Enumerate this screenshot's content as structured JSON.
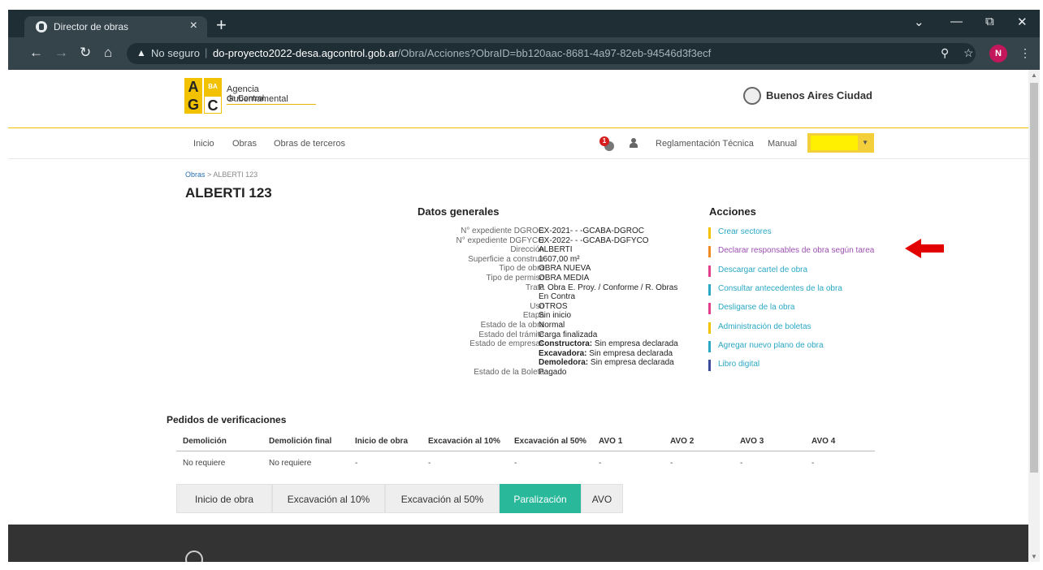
{
  "browser": {
    "tab_title": "Director de obras",
    "tab_close": "×",
    "new_tab": "+",
    "security_label": "No seguro",
    "url_host": "do-proyecto2022-desa.agcontrol.gob.ar",
    "url_path": "/Obra/Acciones?ObraID=bb120aac-8681-4a97-82eb-94546d3f3ecf",
    "profile_initial": "N"
  },
  "header": {
    "logo_line1": "Agencia Gubernamental",
    "logo_line2": "de Control.",
    "logo_letters": [
      "A",
      "BA",
      "G",
      "C"
    ],
    "city_logo": "Buenos Aires Ciudad"
  },
  "nav": {
    "items": [
      "Inicio",
      "Obras",
      "Obras de terceros"
    ],
    "notification_count": "1",
    "reglamentacion": "Reglamentación Técnica",
    "manual": "Manual"
  },
  "breadcrumb": {
    "root": "Obras",
    "separator": ">",
    "current": "ALBERTI 123"
  },
  "obra_title": "ALBERTI 123",
  "datos_generales": {
    "title": "Datos generales",
    "rows": [
      {
        "label": "N° expediente DGROC",
        "value": "EX-2021-               - -GCABA-DGROC"
      },
      {
        "label": "N° expediente DGFYCO",
        "value": "EX-2022-               - -GCABA-DGFYCO"
      },
      {
        "label": "Dirección",
        "value": "ALBERTI"
      },
      {
        "label": "Superficie a construir",
        "value": "1607,00 m²"
      },
      {
        "label": "Tipo de obra",
        "value": "OBRA NUEVA"
      },
      {
        "label": "Tipo de permiso",
        "value": "OBRA MEDIA"
      },
      {
        "label": "Trata",
        "value": "P. Obra E. Proy. / Conforme / R. Obras"
      },
      {
        "label": "",
        "value": "En Contra"
      },
      {
        "label": "Uso",
        "value": "OTROS"
      },
      {
        "label": "Etapa",
        "value": "Sin inicio"
      },
      {
        "label": "Estado de la obra",
        "value": "Normal"
      },
      {
        "label": "Estado del trámite",
        "value": "Carga finalizada"
      }
    ],
    "empresas_label": "Estado de empresas",
    "empresas": [
      {
        "name": "Constructora:",
        "value": " Sin empresa declarada"
      },
      {
        "name": "Excavadora:",
        "value": " Sin empresa declarada"
      },
      {
        "name": "Demoledora:",
        "value": " Sin empresa declarada"
      }
    ],
    "boleta_label": "Estado de la Boleta",
    "boleta_value": "Pagado"
  },
  "acciones": {
    "title": "Acciones",
    "items": [
      {
        "label": "Crear sectores",
        "color": "#f2c200",
        "text_color": "#2aa8c4"
      },
      {
        "label": "Declarar responsables de obra según tarea",
        "color": "#f08a24",
        "text_color": "#9b4fb0"
      },
      {
        "label": "Descargar cartel de obra",
        "color": "#e0408a",
        "text_color": "#2aa8c4"
      },
      {
        "label": "Consultar antecedentes de la obra",
        "color": "#2aa8c4",
        "text_color": "#2aa8c4"
      },
      {
        "label": "Desligarse de la obra",
        "color": "#e0408a",
        "text_color": "#2aa8c4"
      },
      {
        "label": "Administración de boletas",
        "color": "#f2c200",
        "text_color": "#2aa8c4"
      },
      {
        "label": "Agregar nuevo plano de obra",
        "color": "#2aa8c4",
        "text_color": "#2aa8c4"
      },
      {
        "label": "Libro digital",
        "color": "#3c4a9c",
        "text_color": "#2aa8c4"
      }
    ]
  },
  "pedidos": {
    "title": "Pedidos de verificaciones",
    "headers": [
      "Demolición",
      "Demolición final",
      "Inicio de obra",
      "Excavación al 10%",
      "Excavación al 50%",
      "AVO 1",
      "AVO 2",
      "AVO 3",
      "AVO 4"
    ],
    "row": [
      "No requiere",
      "No requiere",
      "-",
      "-",
      "-",
      "-",
      "-",
      "-",
      "-"
    ]
  },
  "action_buttons": [
    {
      "label": "Inicio de obra",
      "active": false
    },
    {
      "label": "Excavación al 10%",
      "active": false
    },
    {
      "label": "Excavación al 50%",
      "active": false
    },
    {
      "label": "Paralización",
      "active": true
    },
    {
      "label": "AVO",
      "active": false
    }
  ],
  "colors": {
    "accent": "#2ab89a",
    "brand_yellow": "#f2c200",
    "arrow_red": "#e30000",
    "footer": "#333333"
  }
}
